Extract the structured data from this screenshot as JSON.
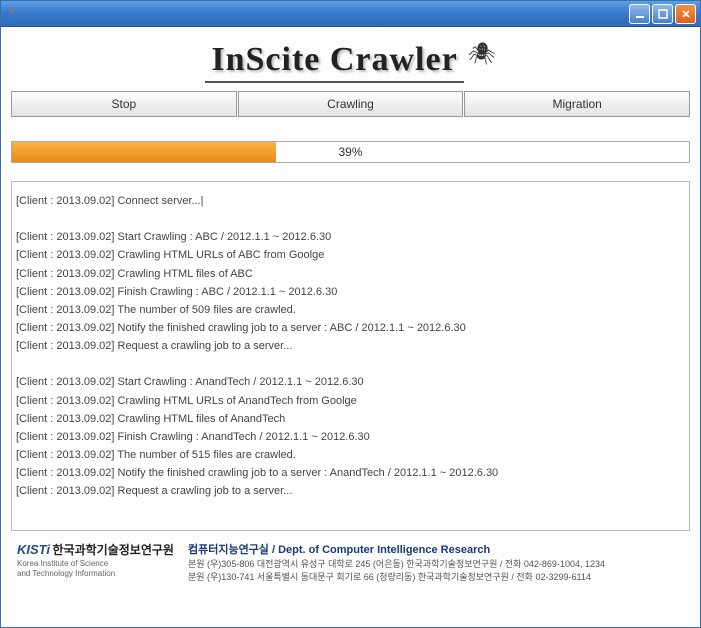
{
  "window": {
    "title": ""
  },
  "logo": {
    "text": "InScite Crawler"
  },
  "tabs": {
    "stop": "Stop",
    "crawling": "Crawling",
    "migration": "Migration"
  },
  "progress": {
    "percent": 39,
    "label": "39%"
  },
  "log_lines": [
    "[Client : 2013.09.02] Connect server...|",
    "",
    "[Client : 2013.09.02] Start Crawling : ABC / 2012.1.1 ~ 2012.6.30",
    "[Client : 2013.09.02] Crawling HTML URLs of ABC from Goolge",
    "[Client : 2013.09.02] Crawling HTML files of ABC",
    "[Client : 2013.09.02] Finish Crawling : ABC / 2012.1.1 ~ 2012.6.30",
    "[Client : 2013.09.02] The number of 509 files are crawled.",
    "[Client : 2013.09.02] Notify the finished crawling job to a server : ABC / 2012.1.1 ~ 2012.6.30",
    "[Client : 2013.09.02] Request a crawling job to a server...",
    "",
    "[Client : 2013.09.02] Start Crawling : AnandTech / 2012.1.1 ~ 2012.6.30",
    "[Client : 2013.09.02] Crawling HTML URLs of AnandTech from Goolge",
    "[Client : 2013.09.02] Crawling HTML files of AnandTech",
    "[Client : 2013.09.02] Finish Crawling : AnandTech / 2012.1.1 ~ 2012.6.30",
    "[Client : 2013.09.02] The number of 515 files are crawled.",
    "[Client : 2013.09.02] Notify the finished crawling job to a server : AnandTech / 2012.1.1 ~ 2012.6.30",
    "[Client : 2013.09.02] Request a crawling job to a server..."
  ],
  "footer": {
    "kisti": "KISTi",
    "org_kr": "한국과학기술정보연구원",
    "org_en1": "Korea Institute of Science",
    "org_en2": "and Technology Information",
    "dept": "컴퓨터지능연구실 / Dept. of Computer Intelligence Research",
    "addr1": "본원 (우)305-806 대전광역시 유성구 대학로 245 (어은동) 한국과학기술정보연구원 / 전화 042-869-1004, 1234",
    "addr2": "분원 (우)130-741 서울특별시 동대문구 회기로 66 (청량리동) 한국과학기술정보연구원 / 전화 02-3299-6114"
  }
}
